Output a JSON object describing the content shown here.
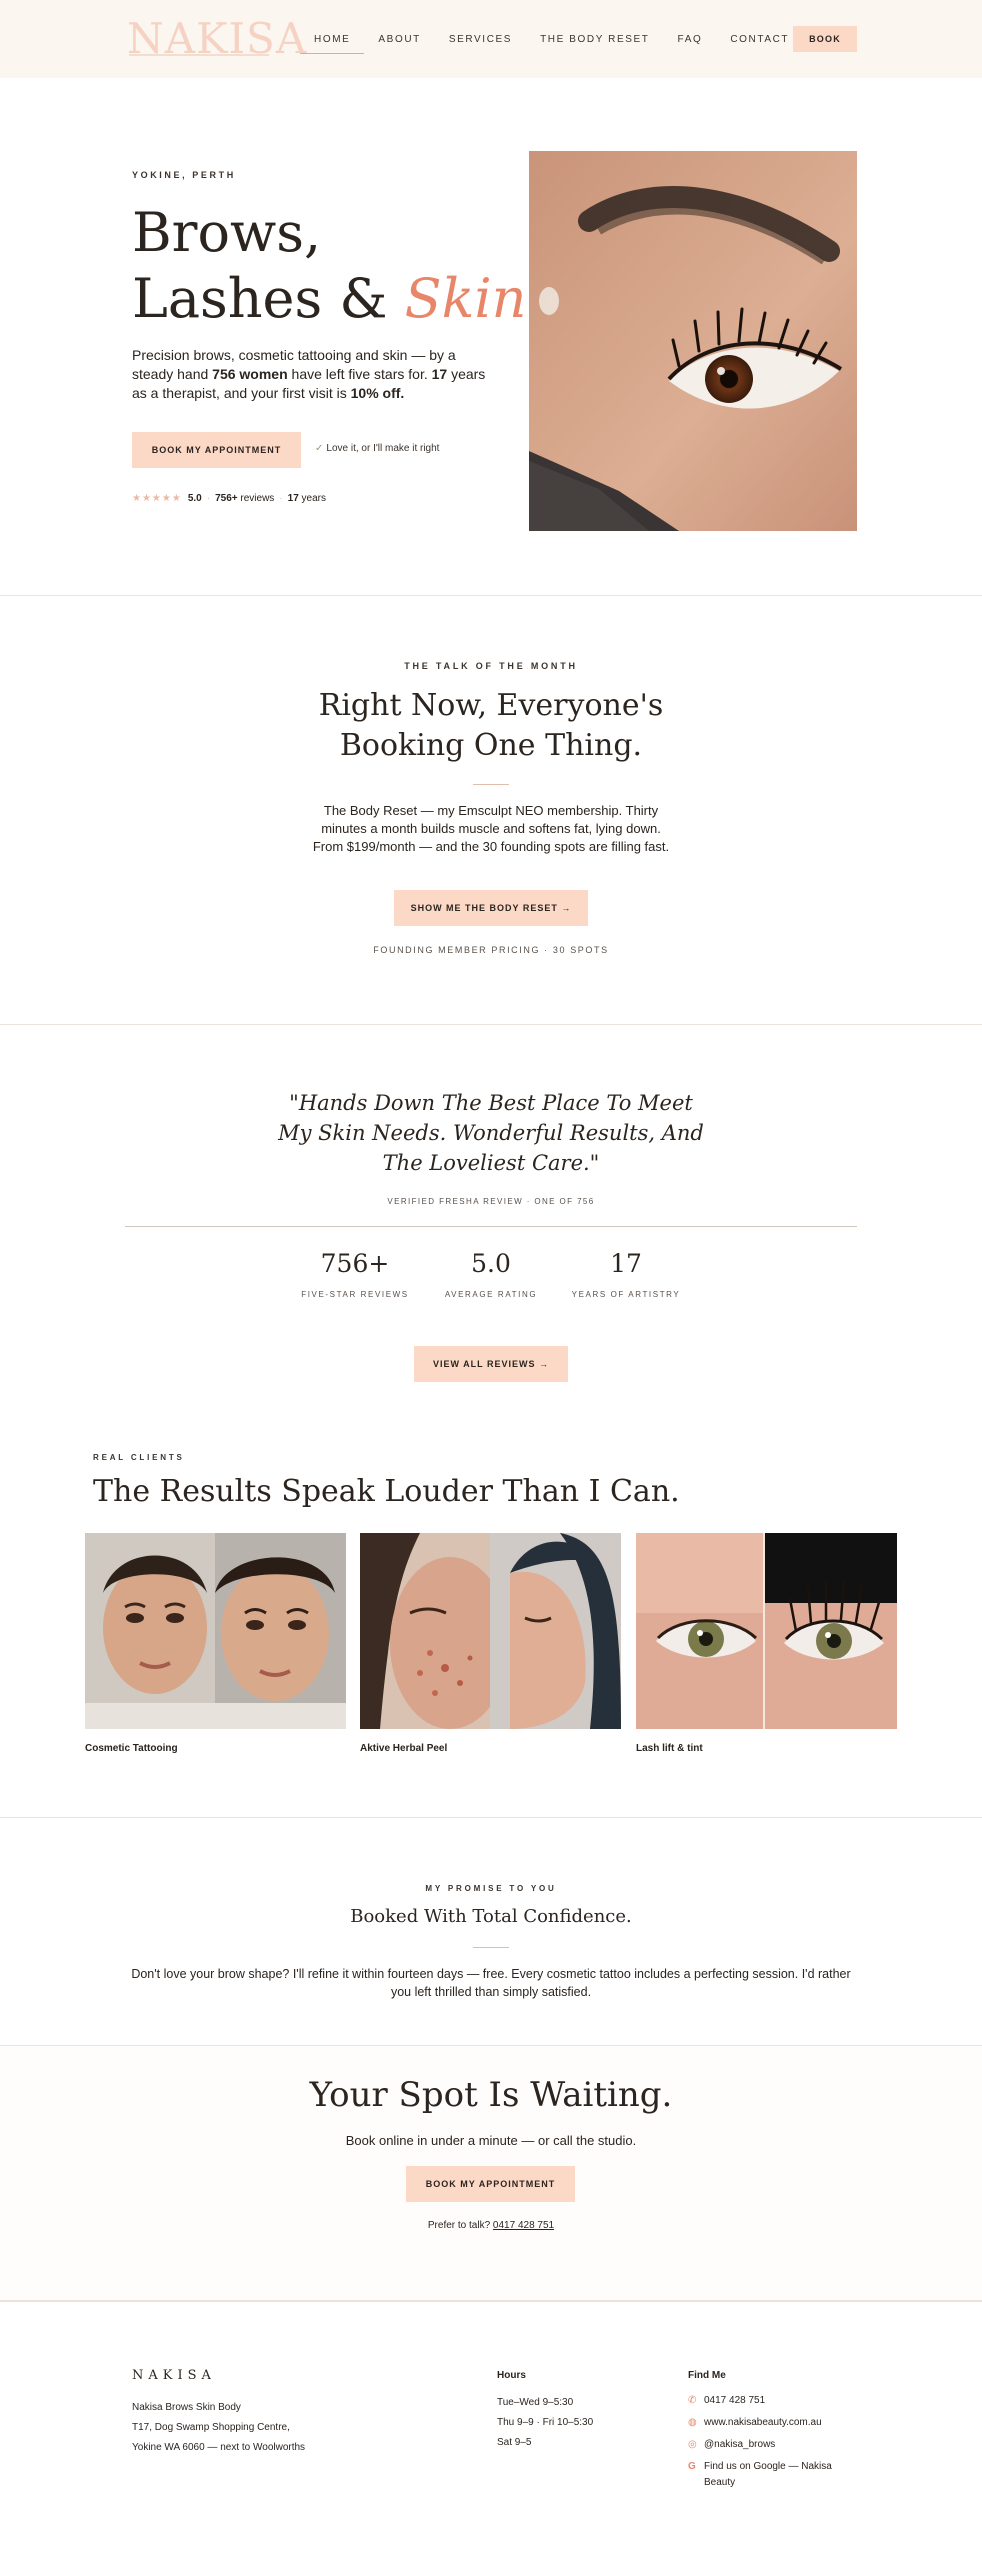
{
  "nav": {
    "logo": "NAKISA",
    "links": [
      "HOME",
      "ABOUT",
      "SERVICES",
      "THE BODY RESET",
      "FAQ",
      "CONTACT"
    ],
    "book": "BOOK"
  },
  "hero": {
    "eyebrow": "YOKINE, PERTH",
    "title_line1": "Brows,",
    "title_line2": "Lashes &",
    "title_accent": "Skin.",
    "body_1": "Precision brows, cosmetic tattooing and skin — by a steady hand ",
    "body_bold_1": "756 women",
    "body_2": " have left five stars for. ",
    "body_bold_2": "17",
    "body_3": " years as a therapist, and your first visit is ",
    "body_bold_3": "10% off.",
    "cta": "BOOK MY APPOINTMENT",
    "guarantee": "Love it, or I'll make it right",
    "stars": "★★★★★",
    "rating": "5.0",
    "reviews_count": "756+",
    "reviews_word": "reviews",
    "years_count": "17",
    "years_word": "years"
  },
  "talk": {
    "eyebrow": "THE TALK OF THE MONTH",
    "title": "Right Now, Everyone's Booking One Thing.",
    "body": "The Body Reset — my Emsculpt NEO membership. Thirty minutes a month builds muscle and softens fat, lying down. From $199/month — and the 30 founding spots are filling fast.",
    "cta": "SHOW ME THE BODY RESET →",
    "note": "FOUNDING MEMBER PRICING · 30 SPOTS"
  },
  "review": {
    "quote": "\"Hands Down The Best Place To Meet My Skin Needs. Wonderful Results, And The Loveliest Care.\"",
    "source": "VERIFIED FRESHA REVIEW · ONE OF 756",
    "stats": [
      {
        "num": "756+",
        "label": "FIVE-STAR REVIEWS"
      },
      {
        "num": "5.0",
        "label": "AVERAGE RATING"
      },
      {
        "num": "17",
        "label": "YEARS OF ARTISTRY"
      }
    ],
    "cta": "VIEW ALL REVIEWS →"
  },
  "results": {
    "eyebrow": "REAL CLIENTS",
    "title": "The Results Speak Louder Than I Can.",
    "cards": [
      {
        "label": "Cosmetic Tattooing"
      },
      {
        "label": "Aktive Herbal Peel"
      },
      {
        "label": "Lash lift & tint"
      }
    ]
  },
  "promise": {
    "eyebrow": "MY PROMISE TO YOU",
    "title": "Booked With Total Confidence.",
    "body": "Don't love your brow shape? I'll refine it within fourteen days — free. Every cosmetic tattoo includes a perfecting session. I'd rather you left thrilled than simply satisfied."
  },
  "spot": {
    "title": "Your Spot Is Waiting.",
    "sub": "Book online in under a minute — or call the studio.",
    "cta": "BOOK MY APPOINTMENT",
    "talk_prefix": "Prefer to talk? ",
    "phone": "0417 428 751"
  },
  "footer": {
    "logo": "NAKISA",
    "address": [
      "Nakisa Brows Skin Body",
      "T17, Dog Swamp Shopping Centre,",
      "Yokine WA 6060 — next to Woolworths"
    ],
    "hours_title": "Hours",
    "hours": [
      "Tue–Wed 9–5:30",
      "Thu 9–9 · Fri 10–5:30",
      "Sat 9–5"
    ],
    "find_title": "Find Me",
    "find": [
      {
        "icon": "phone-icon",
        "text": "0417 428 751"
      },
      {
        "icon": "globe-icon",
        "text": "www.nakisabeauty.com.au"
      },
      {
        "icon": "instagram-icon",
        "text": "@nakisa_brows"
      },
      {
        "icon": "google-icon",
        "text": "Find us on Google — Nakisa Beauty"
      }
    ]
  },
  "colors": {
    "accent": "#e8866a",
    "button": "#fcd9c6",
    "nav_bg": "#fbf6f0",
    "text": "#2b241f"
  }
}
